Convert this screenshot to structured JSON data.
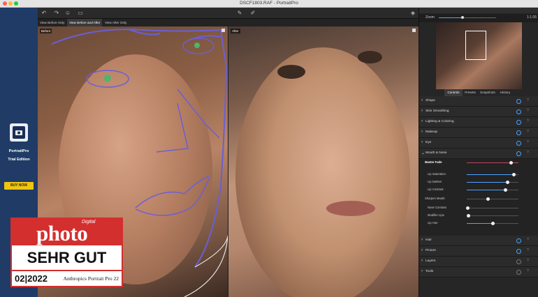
{
  "window": {
    "title": "DSCF1803.RAF - PortraitPro"
  },
  "promo": {
    "product": "PortraitPro",
    "edition": "Trial Edition",
    "buy_label": "BUY NOW"
  },
  "view_modes": [
    "View Before Only",
    "View Before and After",
    "View After Only"
  ],
  "panes": {
    "before_label": "Before",
    "after_label": "After"
  },
  "zoom": {
    "label": "Zoom",
    "value": "1:1.05",
    "level": 0.4
  },
  "tabs": [
    "Controls",
    "Presets",
    "Snapshots",
    "History"
  ],
  "sections": [
    {
      "label": "Shape",
      "on": true
    },
    {
      "label": "Skin Smoothing",
      "on": true
    },
    {
      "label": "Lighting & Coloring",
      "on": true
    },
    {
      "label": "Makeup",
      "on": true
    },
    {
      "label": "Eye",
      "on": true
    },
    {
      "label": "Mouth & Nose",
      "on": true
    }
  ],
  "mouth_nose": {
    "master_fade_label": "Master Fade",
    "master_fade": 0.85,
    "sliders": [
      {
        "label": "Lip Saturation",
        "value": 0.9
      },
      {
        "label": "Lip Darken",
        "value": 0.78
      },
      {
        "label": "Lip Contrast",
        "value": 0.74
      }
    ],
    "sharpen_mouth_label": "Sharpen Mouth",
    "sharpen_mouth": 0.4,
    "sub_sliders": [
      {
        "label": "Nose Contrast",
        "value": 0.02
      },
      {
        "label": "Modifier Lips",
        "value": 0.03
      },
      {
        "label": "Lip Hue",
        "value": 0.5
      }
    ]
  },
  "lower_sections": [
    {
      "label": "Hair",
      "on": true
    },
    {
      "label": "Picture",
      "on": true
    },
    {
      "label": "Layers",
      "on": false
    },
    {
      "label": "Tools",
      "on": false
    }
  ],
  "award": {
    "digital": "Digital",
    "photo": "photo",
    "rating": "SEHR GUT",
    "date": "02|2022",
    "product": "Anthropics Portrait Pro 22"
  }
}
